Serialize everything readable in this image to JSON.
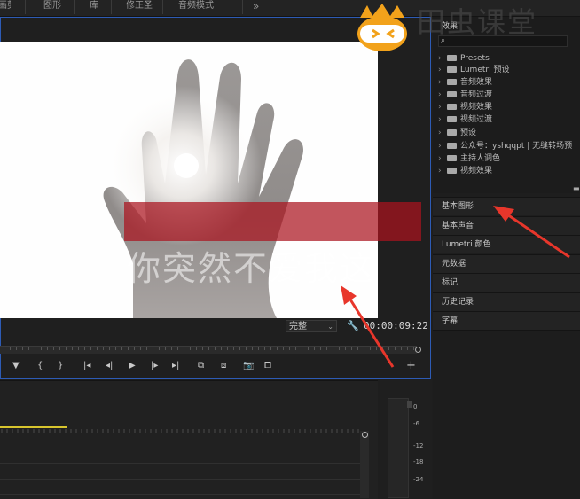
{
  "top_menu": [
    "画剪",
    "图形",
    "库",
    "修正圣",
    "音频模式"
  ],
  "top_menu_more": "»",
  "program_monitor": {
    "title_text": "你突然不爱我这",
    "fit_label": "完整",
    "timecode": "00:00:09:22"
  },
  "transport_icons": [
    "marker-icon",
    "in-point-icon",
    "out-point-icon",
    "go-to-in-icon",
    "step-back-icon",
    "play-icon",
    "step-forward-icon",
    "go-to-out-icon",
    "lift-icon",
    "extract-icon",
    "export-frame-icon",
    "comparison-icon",
    "add-button-icon"
  ],
  "transport_glyphs": [
    "▼",
    "{",
    "}",
    "|◂",
    "◂|",
    "▶",
    "|▸",
    "▸|",
    "⧉",
    "⧈",
    "📷",
    "⧠",
    "+"
  ],
  "effects_panel": {
    "title": "效果",
    "search_placeholder": "",
    "items": [
      {
        "label": "Presets"
      },
      {
        "label": "Lumetri 预设"
      },
      {
        "label": "音频效果"
      },
      {
        "label": "音频过渡"
      },
      {
        "label": "视频效果"
      },
      {
        "label": "视频过渡"
      },
      {
        "label": "预设"
      },
      {
        "label": "公众号：yshqqpt | 无缝转场预"
      },
      {
        "label": "主持人调色"
      },
      {
        "label": "视频效果"
      }
    ]
  },
  "side_panels": [
    "基本图形",
    "基本声音",
    "Lumetri 颜色",
    "元数据",
    "标记",
    "历史记录",
    "字幕"
  ],
  "meter_labels": [
    "0",
    "-6",
    "-12",
    "-18",
    "-24"
  ],
  "watermark": {
    "text": "田虫课堂"
  },
  "colors": {
    "accent_blue": "#2d5bb5",
    "title_red": "#aa141e",
    "timeline_yellow": "#d8c52e",
    "arrow_red": "#e8362b"
  }
}
